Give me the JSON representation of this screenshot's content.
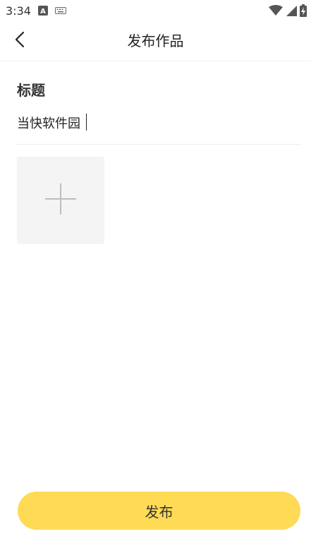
{
  "status_bar": {
    "time": "3:34",
    "notification_icons": [
      "a-notification-icon",
      "keyboard-icon"
    ],
    "system_icons": [
      "wifi-icon",
      "signal-icon",
      "battery-charging-icon"
    ]
  },
  "app_bar": {
    "back_icon": "back-arrow-icon",
    "title": "发布作品"
  },
  "form": {
    "title_label": "标题",
    "title_value": "当快软件园",
    "add_image_icon": "plus-icon"
  },
  "footer": {
    "publish_label": "发布",
    "publish_color": "#ffda55"
  }
}
